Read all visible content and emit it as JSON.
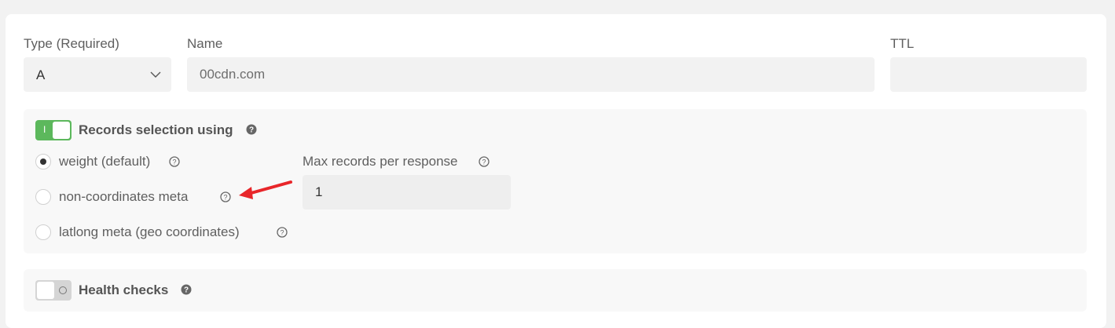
{
  "form": {
    "type_label": "Type (Required)",
    "type_value": "A",
    "name_label": "Name",
    "name_value": "00cdn.com",
    "ttl_label": "TTL",
    "ttl_value": ""
  },
  "records_selection": {
    "title": "Records selection using",
    "enabled": true,
    "options": [
      {
        "label": "weight (default)",
        "checked": true
      },
      {
        "label": "non-coordinates meta",
        "checked": false
      },
      {
        "label": "latlong meta (geo coordinates)",
        "checked": false
      }
    ],
    "max_records_label": "Max records per response",
    "max_records_value": "1"
  },
  "health_checks": {
    "title": "Health checks",
    "enabled": false
  },
  "annotation": {
    "arrow_color": "#e8262a"
  },
  "icons": {
    "help": "question-circle-icon",
    "chevron": "chevron-down-icon",
    "arrow": "red-arrow-annotation-icon"
  }
}
